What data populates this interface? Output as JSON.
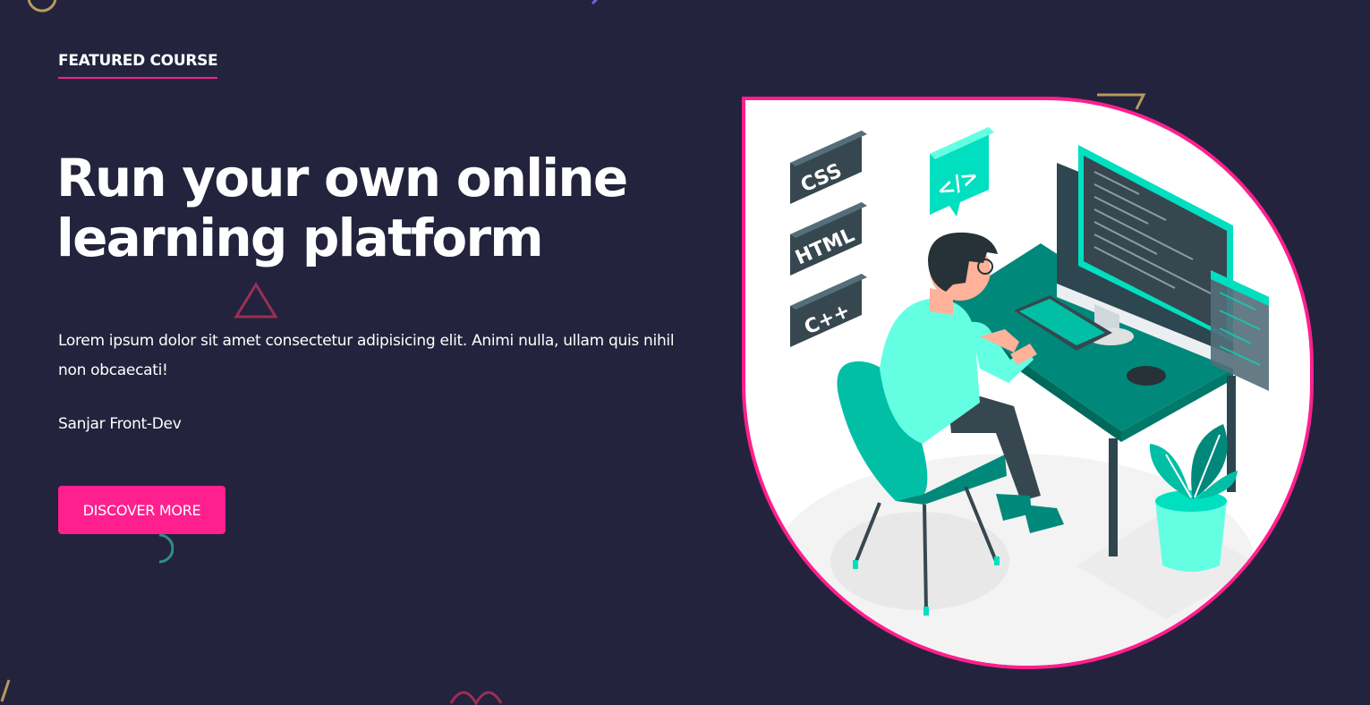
{
  "hero": {
    "eyebrow": "FEATURED COURSE",
    "title_line1": "Run your own online",
    "title_line2": "learning platform",
    "description": "Lorem ipsum dolor sit amet consectetur adipisicing elit. Animi nulla, ullam quis nihil non obcaecati!",
    "author": "Sanjar Front-Dev",
    "cta_label": "DISCOVER MORE"
  },
  "illustration": {
    "badges": [
      "CSS",
      "HTML",
      "C++"
    ],
    "code_tag": "</>",
    "subject": "developer-at-computer-desk"
  },
  "colors": {
    "background": "#23233d",
    "accent": "#ff1f8e",
    "text": "#ffffff",
    "teal": "#00dfc0",
    "dark_teal": "#2d4650"
  }
}
